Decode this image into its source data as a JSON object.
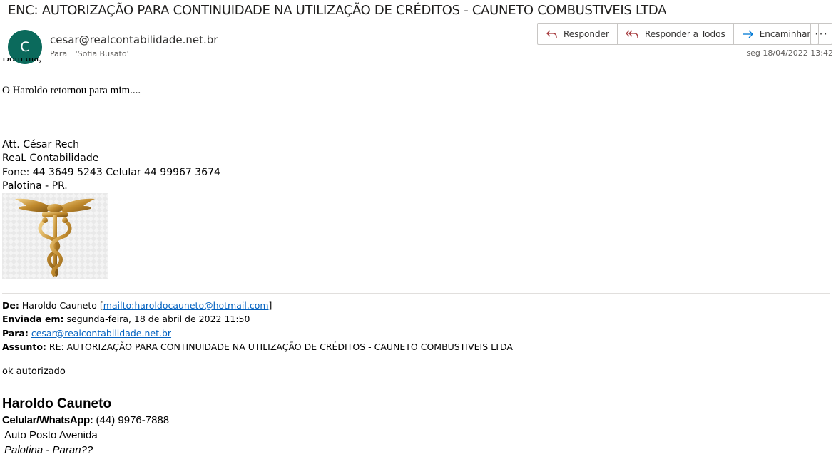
{
  "message": {
    "subject": "ENC: AUTORIZAÇÃO PARA CONTINUIDADE NA UTILIZAÇÃO DE CRÉDITOS - CAUNETO COMBUSTIVEIS LTDA",
    "avatar_initial": "C",
    "sender": "cesar@realcontabilidade.net.br",
    "to_label": "Para",
    "to_value": "'Sofia Busato'",
    "date": "seg 18/04/2022 13:42"
  },
  "toolbar": {
    "reply_label": "Responder",
    "reply_all_label": "Responder a Todos",
    "forward_label": "Encaminhar",
    "more_label": "···"
  },
  "body": {
    "clipped_line": "Bom dia,",
    "intro": "O Haroldo retornou para mim....",
    "signature": [
      "Att. César Rech",
      "ReaL Contabilidade",
      "Fone: 44 3649 5243 Celular 44 99967 3674",
      "Palotina - PR."
    ],
    "forward_header": {
      "from_label": "De:",
      "from_name": "Haroldo Cauneto",
      "from_link": "mailto:haroldocauneto@hotmail.com",
      "sent_label": "Enviada em:",
      "sent_value": "segunda-feira, 18 de abril de 2022 11:50",
      "to_label": "Para:",
      "to_link": "cesar@realcontabilidade.net.br",
      "subject_label": "Assunto:",
      "subject_value": "RE: AUTORIZAÇÃO PARA CONTINUIDADE NA UTILIZAÇÃO DE CRÉDITOS - CAUNETO COMBUSTIVEIS LTDA"
    },
    "reply_text": "ok autorizado",
    "signature2": {
      "name": "Haroldo Cauneto",
      "phone_label": "Celular/WhatsApp:",
      "phone_value": "(44) 9976-7888",
      "company": "Auto Posto Avenida",
      "location": "Palotina - Paran??"
    }
  },
  "icons": {
    "reply": "reply-icon",
    "reply_all": "reply-all-icon",
    "forward": "forward-icon",
    "logo": "caduceus-logo"
  },
  "colors": {
    "avatar": "#0b6a5c",
    "icon_accent": "#a4373a",
    "forward_accent": "#0078d4",
    "link": "#0563c1"
  }
}
